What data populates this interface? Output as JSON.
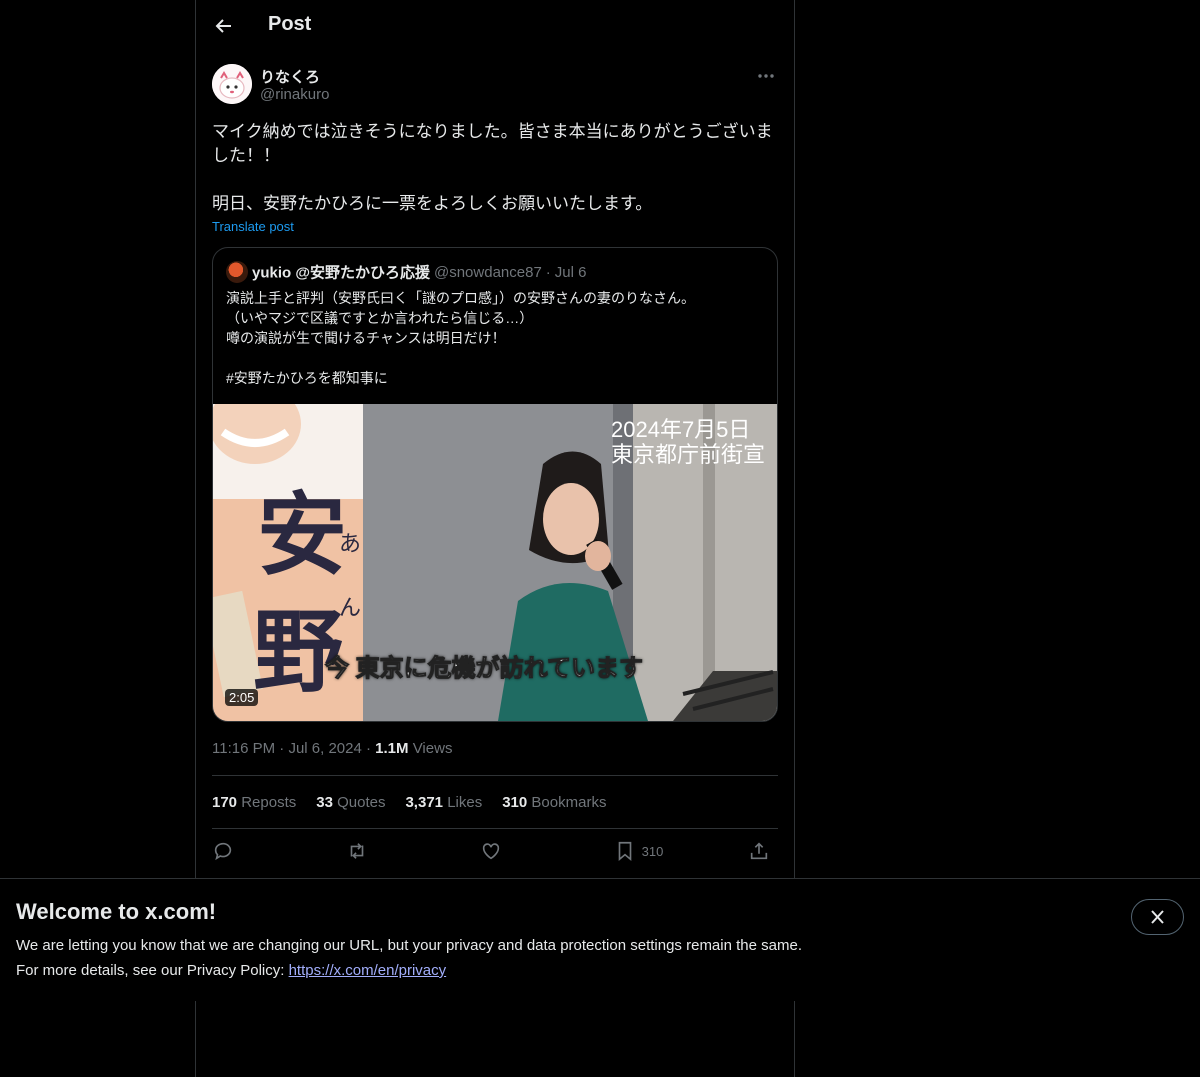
{
  "header": {
    "title": "Post"
  },
  "post": {
    "display_name": "りなくろ",
    "handle": "@rinakuro",
    "text_lines": [
      "マイク納めでは泣きそうになりました。皆さま本当にありがとうございました！！",
      "明日、安野たかひろに一票をよろしくお願いいたします。"
    ],
    "translate_label": "Translate post",
    "time": "11:16 PM",
    "date": "Jul 6, 2024",
    "views_count": "1.1M",
    "views_label": "Views"
  },
  "quote": {
    "display_name": "yukio @安野たかひろ応援",
    "handle": "@snowdance87",
    "date": "Jul 6",
    "lines": [
      "演説上手と評判（安野氏曰く「謎のプロ感」）の安野さんの妻のりなさん。",
      "（いやマジで区議ですとか言われたら信じる…）",
      "噂の演説が生で聞けるチャンスは明日だけ！",
      "#安野たかひろを都知事に"
    ],
    "video": {
      "caption_date": "2024年7月5日",
      "caption_place": "東京都庁前街宣",
      "subtitle": "今 東京に危機が訪れています",
      "banner_big_1": "安",
      "banner_big_2": "野",
      "banner_small_1": "あ",
      "banner_small_2": "ん",
      "duration": "2:05"
    }
  },
  "stats": {
    "reposts_count": "170",
    "reposts_label": "Reposts",
    "quotes_count": "33",
    "quotes_label": "Quotes",
    "likes_count": "3,371",
    "likes_label": "Likes",
    "bookmarks_count": "310",
    "bookmarks_label": "Bookmarks"
  },
  "actions": {
    "bookmark_count": "310"
  },
  "banner": {
    "title": "Welcome to x.com!",
    "line1": "We are letting you know that we are changing our URL, but your privacy and data protection settings remain the same.",
    "line2_prefix": "For more details, see our Privacy Policy: ",
    "link": "https://x.com/en/privacy"
  },
  "icons": [
    "back-arrow-icon",
    "more-icon",
    "reply-icon",
    "repost-icon",
    "like-icon",
    "bookmark-icon",
    "share-icon",
    "close-icon"
  ],
  "colors": {
    "background": "#000000",
    "text": "#e7e9ea",
    "muted": "#71767b",
    "accent": "#1d9bf0",
    "border": "#2f3336"
  }
}
